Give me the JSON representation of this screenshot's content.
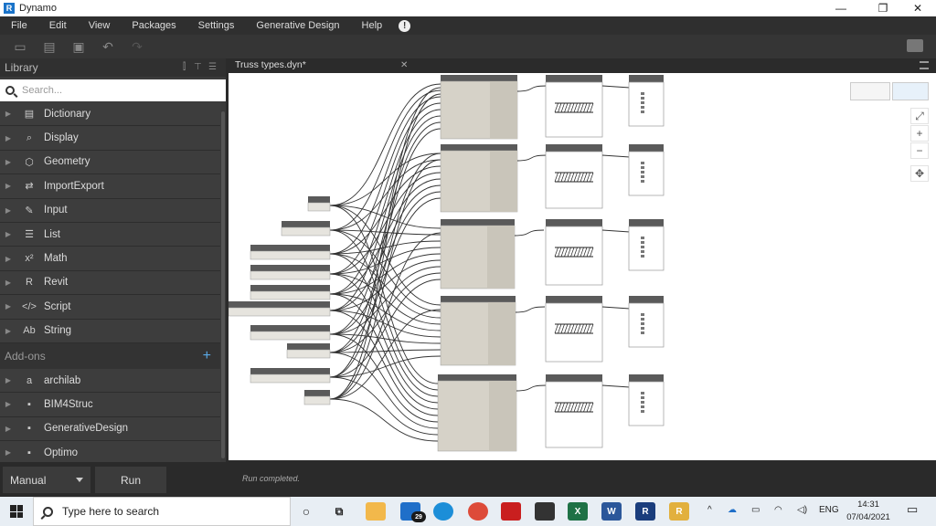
{
  "window": {
    "title": "Dynamo",
    "logo_letter": "R",
    "min": "—",
    "restore": "❐",
    "close": "✕"
  },
  "menu": [
    "File",
    "Edit",
    "View",
    "Packages",
    "Settings",
    "Generative Design",
    "Help"
  ],
  "library": {
    "title": "Library",
    "search_placeholder": "Search...",
    "items": [
      {
        "label": "Dictionary",
        "icon": "dictionary-icon",
        "glyph": "▤"
      },
      {
        "label": "Display",
        "icon": "display-icon",
        "glyph": "⌕"
      },
      {
        "label": "Geometry",
        "icon": "geometry-icon",
        "glyph": "⬡"
      },
      {
        "label": "ImportExport",
        "icon": "import-export-icon",
        "glyph": "⇄"
      },
      {
        "label": "Input",
        "icon": "input-icon",
        "glyph": "✎"
      },
      {
        "label": "List",
        "icon": "list-icon",
        "glyph": "☰"
      },
      {
        "label": "Math",
        "icon": "math-icon",
        "glyph": "x²"
      },
      {
        "label": "Revit",
        "icon": "revit-icon",
        "glyph": "R"
      },
      {
        "label": "Script",
        "icon": "script-icon",
        "glyph": "</>"
      },
      {
        "label": "String",
        "icon": "string-icon",
        "glyph": "Ab"
      }
    ],
    "addons_title": "Add-ons",
    "addons": [
      {
        "label": "archilab",
        "icon": "archilab-icon",
        "glyph": "a"
      },
      {
        "label": "BIM4Struc",
        "icon": "package-icon",
        "glyph": "▪"
      },
      {
        "label": "GenerativeDesign",
        "icon": "package-icon",
        "glyph": "▪"
      },
      {
        "label": "Optimo",
        "icon": "package-icon",
        "glyph": "▪"
      }
    ]
  },
  "tab": {
    "label": "Truss types.dyn*",
    "close": "✕"
  },
  "run": {
    "mode": "Manual",
    "button": "Run",
    "status": "Run completed."
  },
  "taskbar": {
    "search_placeholder": "Type here to search",
    "mail_badge": "29",
    "lang": "ENG",
    "time": "14:31",
    "date": "07/04/2021"
  },
  "colors": {
    "accent": "#5aa9e6",
    "canvas": "#ffffff",
    "node_header": "#5a5a5a",
    "node_body": "#d6d2c8"
  }
}
